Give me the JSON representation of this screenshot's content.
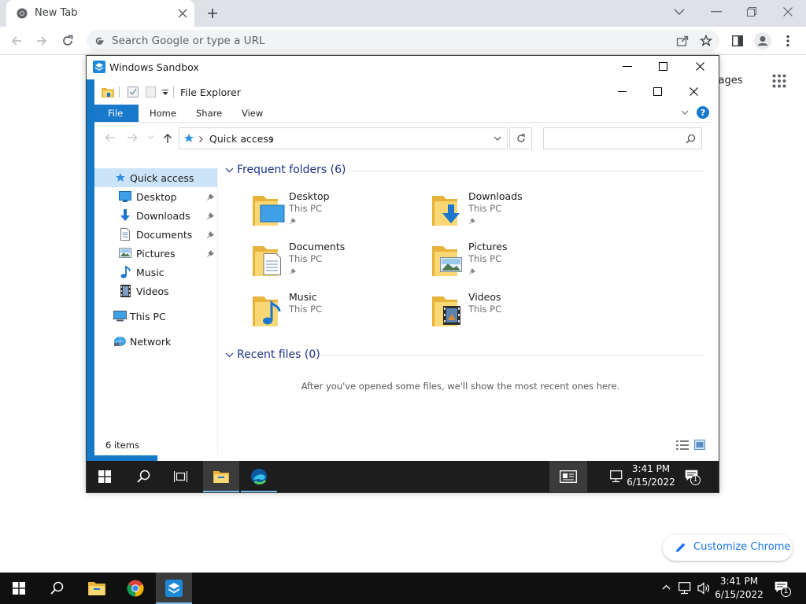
{
  "chrome": {
    "tab_title": "New Tab",
    "omnibox_placeholder": "Search Google or type a URL",
    "images_link": "Images",
    "customize_label": "Customize Chrome"
  },
  "sandbox": {
    "title": "Windows Sandbox",
    "explorer_title": "File Explorer",
    "ribbon_tabs": [
      "File",
      "Home",
      "Share",
      "View"
    ],
    "address_crumb": "Quick access",
    "nav": {
      "quick_access": "Quick access",
      "items": [
        "Desktop",
        "Downloads",
        "Documents",
        "Pictures",
        "Music",
        "Videos"
      ],
      "this_pc": "This PC",
      "network": "Network"
    },
    "frequent_header": "Frequent folders (6)",
    "folders": [
      {
        "name": "Desktop",
        "location": "This PC",
        "icon": "desktop-folder-icon"
      },
      {
        "name": "Downloads",
        "location": "This PC",
        "icon": "downloads-folder-icon"
      },
      {
        "name": "Documents",
        "location": "This PC",
        "icon": "documents-folder-icon"
      },
      {
        "name": "Pictures",
        "location": "This PC",
        "icon": "pictures-folder-icon"
      },
      {
        "name": "Music",
        "location": "This PC",
        "icon": "music-folder-icon"
      },
      {
        "name": "Videos",
        "location": "This PC",
        "icon": "videos-folder-icon"
      }
    ],
    "recent_header": "Recent files (0)",
    "recent_empty": "After you've opened some files, we'll show the most recent ones here.",
    "status_items": "6 items",
    "clock_time": "3:41 PM",
    "clock_date": "6/15/2022",
    "notif_count": "1"
  },
  "taskbar": {
    "clock_time": "3:41 PM",
    "clock_date": "6/15/2022",
    "notif_count": "1"
  },
  "colors": {
    "accent": "#0078d7",
    "file_tab": "#1979ca",
    "section_header": "#1e3287"
  }
}
